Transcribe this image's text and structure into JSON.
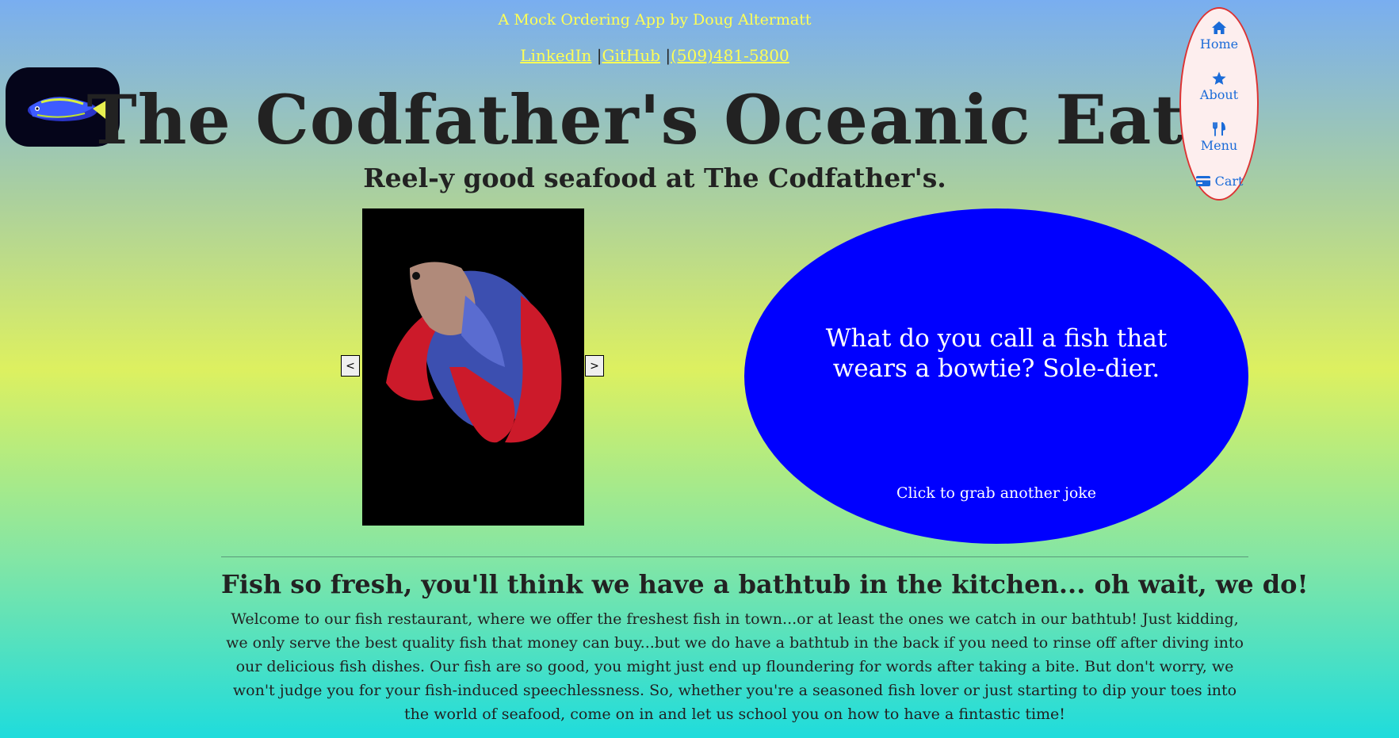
{
  "header": {
    "byline": "A Mock Ordering App by Doug Altermatt",
    "links": [
      {
        "label": "LinkedIn"
      },
      {
        "label": "GitHub"
      },
      {
        "label": "(509)481-5800"
      }
    ],
    "separator": "|",
    "title": "The Codfather's Oceanic Eats",
    "tagline": "Reel-y good seafood at The Codfather's."
  },
  "nav": {
    "items": [
      {
        "label": "Home",
        "icon": "home-icon"
      },
      {
        "label": "About",
        "icon": "star-icon"
      },
      {
        "label": "Menu",
        "icon": "utensils-icon"
      },
      {
        "label": "Cart",
        "icon": "credit-card-icon"
      }
    ]
  },
  "carousel": {
    "prev_label": "<",
    "next_label": ">"
  },
  "joke": {
    "text": "What do you call a fish that wears a bowtie? Sole-dier.",
    "cta": "Click to grab another joke"
  },
  "intro": {
    "headline": "Fish so fresh, you'll think we have a bathtub in the kitchen... oh wait, we do!",
    "body": "Welcome to our fish restaurant, where we offer the freshest fish in town...or at least the ones we catch in our bathtub! Just kidding, we only serve the best quality fish that money can buy...but we do have a bathtub in the back if you need to rinse off after diving into our delicious fish dishes. Our fish are so good, you might just end up floundering for words after taking a bite. But don't worry, we won't judge you for your fish-induced speechlessness. So, whether you're a seasoned fish lover or just starting to dip your toes into the world of seafood, come on in and let us school you on how to have a fintastic time!"
  },
  "colors": {
    "accent_yellow": "#ffff55",
    "nav_blue": "#1a6bd8",
    "joke_blue": "#0000ff"
  }
}
